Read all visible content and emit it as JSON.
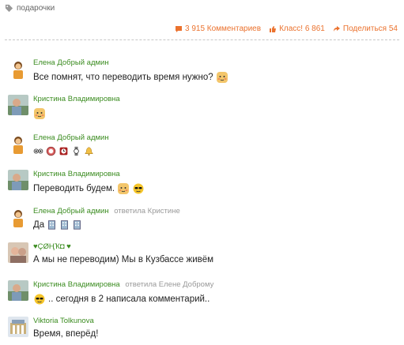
{
  "tag": {
    "label": "подарочки",
    "icon": "tag-icon"
  },
  "stats": {
    "comments_label": "3 915 Комментариев",
    "likes_label": "Класс! 6 861",
    "share_label": "Поделиться 54",
    "accent_color": "#eb722e"
  },
  "colors": {
    "author": "#3b8c20",
    "reply": "#999999"
  },
  "comments": [
    {
      "author": "Елена Добрый админ",
      "reply_to": "",
      "text": "Все помнят, что переводить время нужно?",
      "emoji": [
        "shy-smiley-icon"
      ]
    },
    {
      "author": "Кристина Владимировна",
      "reply_to": "",
      "text": "",
      "emoji": [
        "shy-smiley-icon"
      ]
    },
    {
      "author": "Елена Добрый админ",
      "reply_to": "",
      "text": "",
      "emoji": [
        "eyes-icon",
        "clock-face-icon",
        "alarm-clock-icon",
        "watch-icon",
        "bell-icon"
      ]
    },
    {
      "author": "Кристина Владимировна",
      "reply_to": "",
      "text": "Переводить будем.",
      "emoji": [
        "shy-smiley-icon",
        "cool-sun-icon"
      ]
    },
    {
      "author": "Елена Добрый админ",
      "reply_to": "ответила Кристине",
      "text": "Да",
      "emoji": [
        "building-icon",
        "building-icon",
        "building-icon"
      ]
    },
    {
      "author": "♥ÇØҢҠ◘ ♥",
      "reply_to": "",
      "text": "А мы не переводим) Мы в Кузбассе живём",
      "emoji": []
    },
    {
      "author": "Кристина Владимировна",
      "reply_to": "ответила Елене Доброму",
      "text": ".. сегодня в 2 написала комментарий..",
      "emoji_before": [
        "cool-sun-icon"
      ]
    },
    {
      "author": "Viktoria Tolkunova",
      "reply_to": "",
      "text": "Время, вперёд!",
      "emoji": []
    }
  ]
}
